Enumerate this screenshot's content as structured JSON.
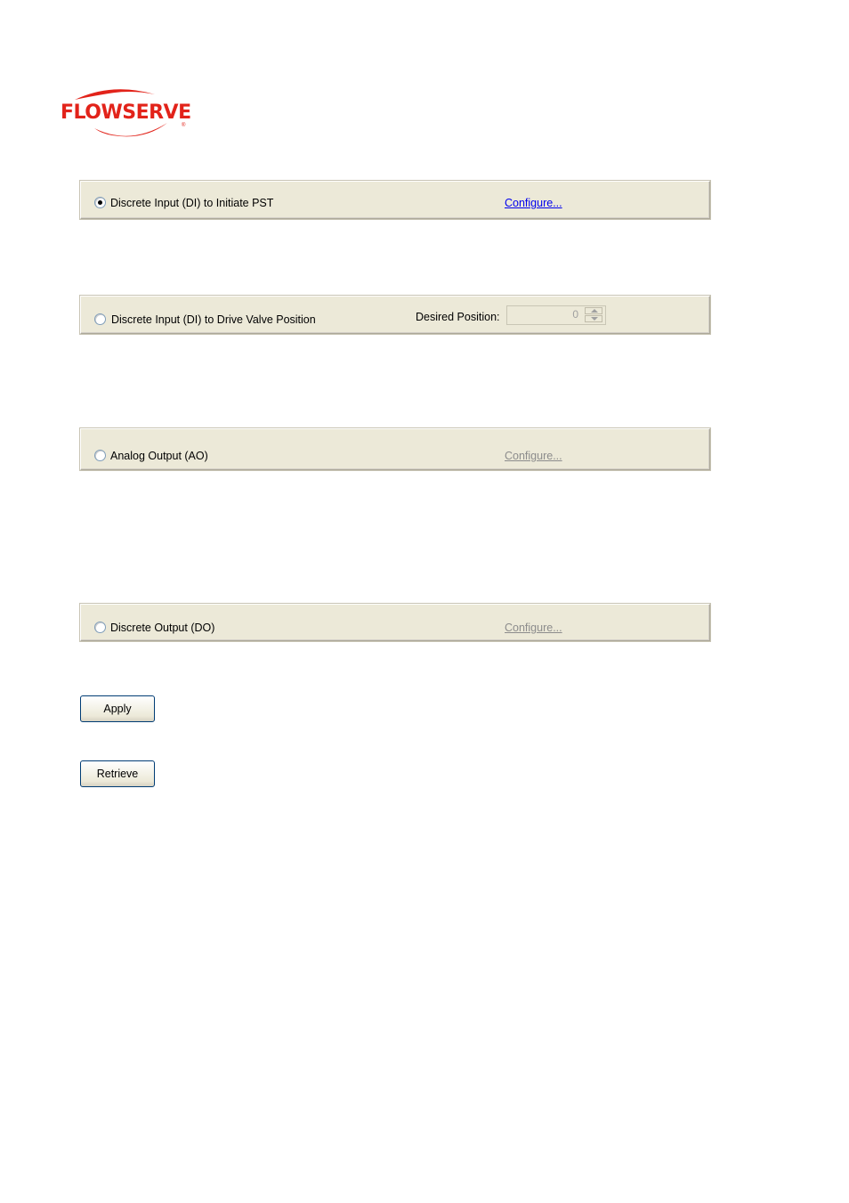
{
  "brand": {
    "name": "FLOWSERVE",
    "color": "#e2231a"
  },
  "options": [
    {
      "label": "Discrete Input (DI) to Initiate PST",
      "selected": true,
      "link": "Configure...",
      "link_enabled": true
    },
    {
      "label": "Discrete Input (DI) to Drive Valve Position",
      "selected": false,
      "desired_position": {
        "label": "Desired Position:",
        "value": "0",
        "enabled": false
      }
    },
    {
      "label": "Analog Output (AO)",
      "selected": false,
      "link": "Configure...",
      "link_enabled": false
    },
    {
      "label": "Discrete Output (DO)",
      "selected": false,
      "link": "Configure...",
      "link_enabled": false
    }
  ],
  "buttons": {
    "apply": "Apply",
    "retrieve": "Retrieve"
  },
  "icons": {
    "logo": "flowserve-swoosh-logo",
    "spin": "spinner-up-down-icon"
  }
}
